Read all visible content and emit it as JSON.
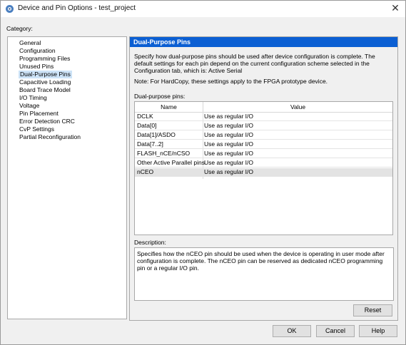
{
  "window": {
    "title": "Device and Pin Options - test_project",
    "close_glyph": "✕"
  },
  "category": {
    "label": "Category:",
    "items": [
      "General",
      "Configuration",
      "Programming Files",
      "Unused Pins",
      "Dual-Purpose Pins",
      "Capacitive Loading",
      "Board Trace Model",
      "I/O Timing",
      "Voltage",
      "Pin Placement",
      "Error Detection CRC",
      "CvP Settings",
      "Partial Reconfiguration"
    ],
    "selected": "Dual-Purpose Pins"
  },
  "panel": {
    "header": "Dual-Purpose Pins",
    "description": "Specify how dual-purpose pins should be used after device configuration is complete. The default settings for each pin depend on the current configuration scheme selected in the Configuration tab, which is:  Active Serial",
    "note": "Note: For HardCopy, these settings apply to the FPGA prototype device.",
    "table_label": "Dual-purpose pins:",
    "columns": [
      "Name",
      "Value"
    ],
    "rows": [
      {
        "name": "DCLK",
        "value": "Use as regular I/O"
      },
      {
        "name": "Data[0]",
        "value": "Use as regular I/O"
      },
      {
        "name": "Data[1]/ASDO",
        "value": "Use as regular I/O"
      },
      {
        "name": "Data[7..2]",
        "value": "Use as regular I/O"
      },
      {
        "name": "FLASH_nCE/nCSO",
        "value": "Use as regular I/O"
      },
      {
        "name": "Other Active Parallel pins",
        "value": "Use as regular I/O"
      },
      {
        "name": "nCEO",
        "value": "Use as regular I/O"
      }
    ],
    "selected_row": "nCEO",
    "description_label": "Description:",
    "description_text": "Specifies how the nCEO pin should be used when the device is operating in user mode after configuration is complete. The nCEO pin can be reserved as dedicated nCEO programming pin or a regular I/O pin.",
    "reset_label": "Reset"
  },
  "buttons": {
    "ok": "OK",
    "cancel": "Cancel",
    "help": "Help"
  },
  "colors": {
    "header_bg": "#0b5fd3",
    "selection": "#cde3f7"
  },
  "icons": {
    "app": "quartus-app-icon",
    "close": "close-icon"
  }
}
